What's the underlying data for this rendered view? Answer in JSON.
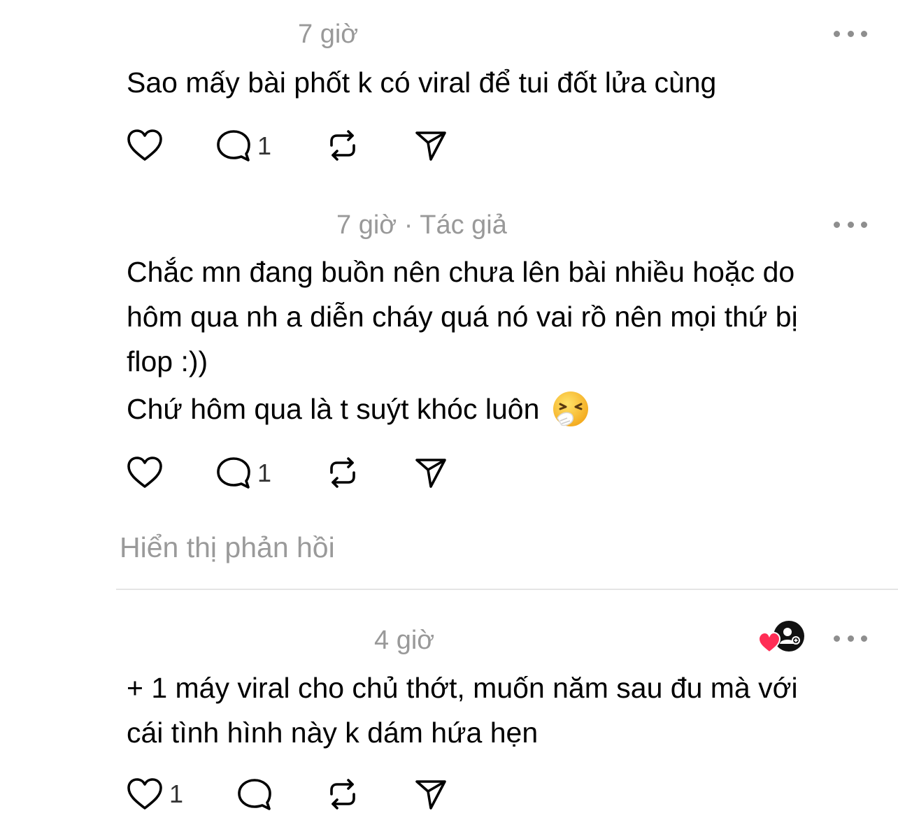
{
  "comments": [
    {
      "time": "7 giờ",
      "text": [
        "Sao mấy bài phốt k có viral để tui đốt lửa cùng"
      ],
      "likes": "",
      "replies": "1",
      "icons": [
        "heart-icon",
        "comment-icon",
        "repost-icon",
        "share-icon",
        "more-icon"
      ]
    },
    {
      "time": "7 giờ · Tác giả",
      "text": [
        "Chắc mn đang buồn nên chưa lên bài nhiều hoặc do",
        "hôm qua nh a diễn cháy quá nó vai rồ nên mọi thứ bị",
        "flop :))",
        "Chứ hôm qua là t suýt khóc luôn"
      ],
      "emoji": "sneezing-face",
      "likes": "",
      "replies": "1",
      "show_replies": "Hiển thị phản hồi"
    },
    {
      "time": "4 giờ",
      "text": [
        "+ 1 máy viral cho chủ thớt, muốn năm sau đu mà với",
        "cái tình hình này k dám hứa hẹn"
      ],
      "likes": "1",
      "replies": "",
      "badge": "liked-by-author-badge"
    }
  ],
  "colors": {
    "text": "#000000",
    "muted": "#999999",
    "heart": "#ff2d55",
    "divider": "#e4e4e4"
  }
}
